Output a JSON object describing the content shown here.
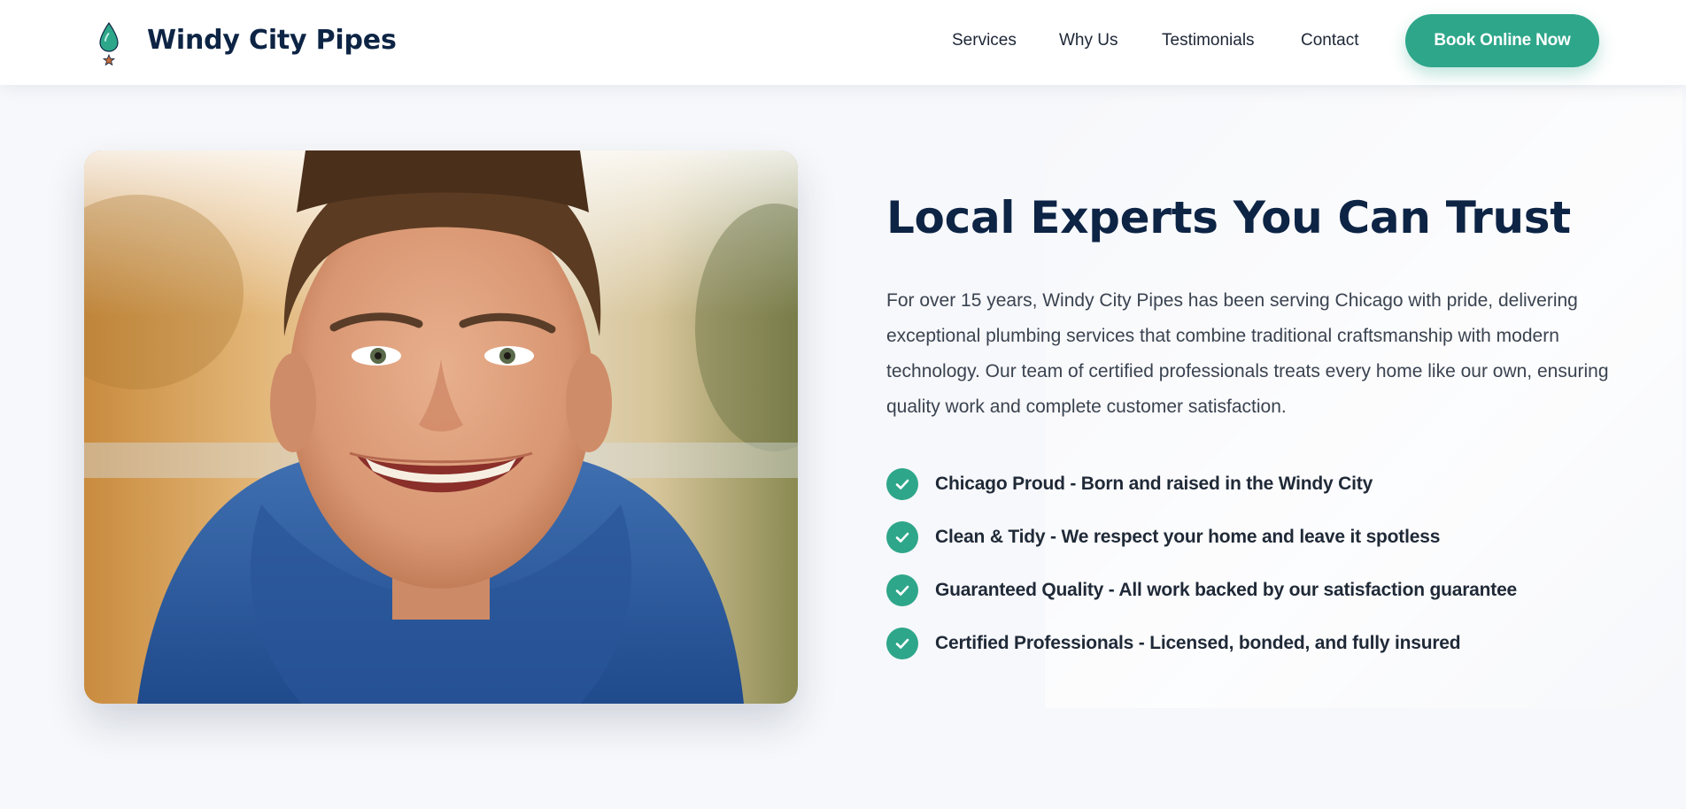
{
  "header": {
    "brand": "Windy City Pipes",
    "logo_icon": "water-drop-star-icon",
    "nav": [
      {
        "label": "Services"
      },
      {
        "label": "Why Us"
      },
      {
        "label": "Testimonials"
      },
      {
        "label": "Contact"
      }
    ],
    "cta_label": "Book Online Now"
  },
  "about": {
    "photo": "smiling-man-blue-hoodie-photo",
    "headline": "Local Experts You Can Trust",
    "body": "For over 15 years, Windy City Pipes has been serving Chicago with pride, delivering exceptional plumbing services that combine traditional craftsmanship with modern technology. Our team of certified professionals treats every home like our own, ensuring quality work and complete customer satisfaction.",
    "check_icon": "check-circle-icon",
    "features": [
      {
        "text": "Chicago Proud - Born and raised in the Windy City"
      },
      {
        "text": "Clean & Tidy - We respect your home and leave it spotless"
      },
      {
        "text": "Guaranteed Quality - All work backed by our satisfaction guarantee"
      },
      {
        "text": "Certified Professionals - Licensed, bonded, and fully insured"
      }
    ]
  },
  "colors": {
    "brand_navy": "#0d2445",
    "accent_teal": "#2ea68a",
    "logo_star": "#c46a3a",
    "page_background": "#f7f8fb"
  }
}
